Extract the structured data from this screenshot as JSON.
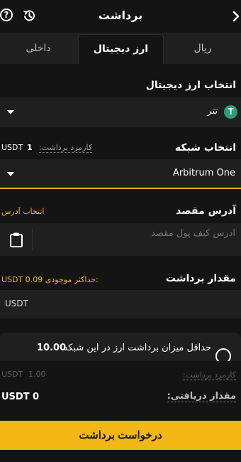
{
  "header": {
    "title": "برداشت",
    "help_glyph": "?",
    "icons": {
      "back": "chevron-right-icon",
      "history": "history-icon",
      "help": "help-icon"
    }
  },
  "tabs": [
    {
      "label": "ریال",
      "active": false
    },
    {
      "label": "ارز دیجیتال",
      "active": true
    },
    {
      "label": "داخلی",
      "active": false
    }
  ],
  "currency": {
    "label": "انتخاب ارز دیجیتال",
    "selected": "تتر",
    "coin_glyph": "T",
    "coin_color": "#26a17b"
  },
  "network": {
    "label": "انتخاب شبکه",
    "fee_label": "کارمزد برداشت:",
    "fee_value": "1",
    "fee_unit": "USDT",
    "selected": "Arbitrum One"
  },
  "address": {
    "label": "آدرس مقصد",
    "choose_link": "انتخاب آدرس",
    "placeholder": "آدرس کیف پول مقصد"
  },
  "amount": {
    "label": "مقدار برداشت",
    "max_label": "حداکثر موجودی:",
    "max_value": "0.09",
    "max_unit": "USDT",
    "unit": "USDT"
  },
  "notice": {
    "text": "حداقل میزان برداشت ارز در این شبکه",
    "value": "10.00"
  },
  "summary": {
    "fee_label": "کارمزد برداشت:",
    "fee_value": "1.00",
    "fee_unit": "USDT",
    "receive_label": "مقدار دریافتی:",
    "receive_value": "0",
    "receive_unit": "USDT"
  },
  "submit_label": "درخواست برداشت",
  "colors": {
    "accent": "#f4b715",
    "background": "#141414",
    "field": "#1f1f1f"
  }
}
